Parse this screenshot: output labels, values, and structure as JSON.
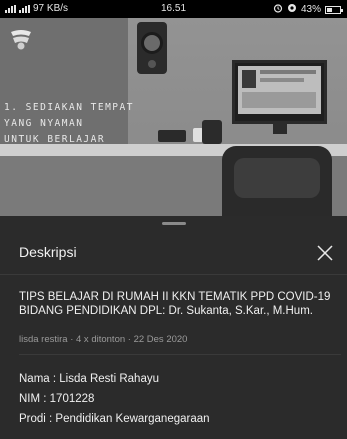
{
  "status_bar": {
    "network_speed": "97 KB/s",
    "time": "16.51",
    "battery": "43%",
    "battery_level": 0.43
  },
  "video": {
    "overlay_lines": [
      "1. SEDIAKAN TEMPAT",
      "YANG NYAMAN",
      "UNTUK BERLAJAR"
    ]
  },
  "sheet": {
    "title": "Deskripsi",
    "video_title": "TIPS BELAJAR DI RUMAH II KKN TEMATIK PPD COVID-19 BIDANG PENDIDIKAN DPL: Dr. Sukanta, S.Kar., M.Hum.",
    "meta": "lisda restira · 4 x ditonton · 22 Des 2020",
    "details": [
      "Nama : Lisda Resti Rahayu",
      "NIM : 1701228",
      "Prodi : Pendidikan Kewarganegaraan"
    ]
  },
  "icons": {
    "close": "close-icon",
    "logo": "university-logo-icon",
    "alarm": "alarm-icon",
    "sync": "sync-icon",
    "battery": "battery-icon",
    "signal": "signal-icon"
  }
}
